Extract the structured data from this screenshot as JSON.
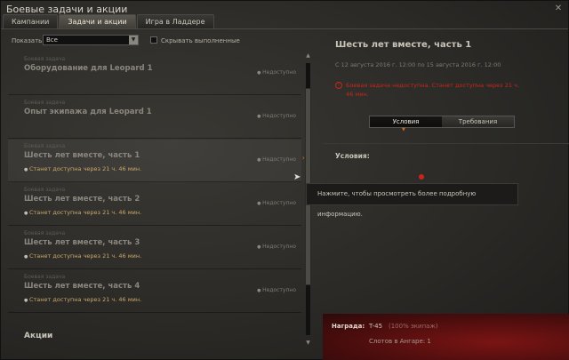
{
  "window": {
    "title": "Боевые задачи и акции",
    "close_icon": "close-icon"
  },
  "tabs": [
    {
      "label": "Кампании",
      "active": false
    },
    {
      "label": "Задачи и акции",
      "active": true
    },
    {
      "label": "Игра в Ладдере",
      "active": false
    }
  ],
  "filter": {
    "show_label": "Показать:",
    "select_value": "Все",
    "hide_completed_label": "Скрывать выполненные",
    "hide_completed_checked": false
  },
  "quests": [
    {
      "category": "Боевая задача",
      "name": "Оборудование для Leopard 1",
      "status": "Недоступно",
      "sub": ""
    },
    {
      "category": "Боевая задача",
      "name": "Опыт экипажа для Leopard 1",
      "status": "Недоступно",
      "sub": ""
    },
    {
      "category": "Боевая задача",
      "name": "Шесть лет вместе, часть 1",
      "status": "Недоступно",
      "sub": "Станет доступна через 21 ч. 46 мин.",
      "selected": true
    },
    {
      "category": "Боевая задача",
      "name": "Шесть лет вместе, часть 2",
      "status": "Недоступно",
      "sub": "Станет доступна через 21 ч. 46 мин."
    },
    {
      "category": "Боевая задача",
      "name": "Шесть лет вместе, часть 3",
      "status": "Недоступно",
      "sub": "Станет доступна через 21 ч. 46 мин."
    },
    {
      "category": "Боевая задача",
      "name": "Шесть лет вместе, часть 4",
      "status": "Недоступно",
      "sub": "Станет доступна через 21 ч. 46 мин."
    }
  ],
  "section_label": "Акции",
  "tooltip": "Нажмите, чтобы просмотреть более подробную информацию.",
  "detail": {
    "title": "Шесть лет вместе, часть 1",
    "dates": "С 12 августа 2016 г. 12:00 по 15 августа 2016 г. 12:00",
    "warning": "Боевая задача недоступна. Станет доступна через 21 ч. 46 мин.",
    "segments": [
      "Условия",
      "Требования"
    ],
    "active_segment": 0,
    "conditions_label": "Условия:"
  },
  "reward": {
    "label": "Награда:",
    "tank": "T-45",
    "crew": "(100% экипаж)",
    "slots": "Слотов в Ангаре: 1"
  },
  "colors": {
    "accent": "#d06b28",
    "warning": "#c8261b",
    "reward_bg": "#6b1212"
  }
}
